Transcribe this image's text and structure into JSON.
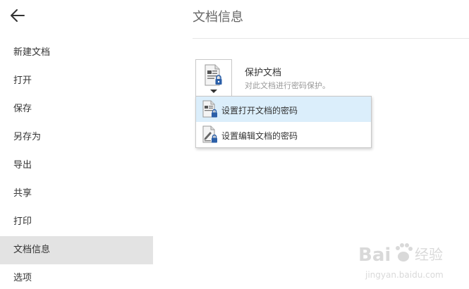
{
  "sidebar": {
    "items": [
      {
        "label": "新建文档"
      },
      {
        "label": "打开"
      },
      {
        "label": "保存"
      },
      {
        "label": "另存为"
      },
      {
        "label": "导出"
      },
      {
        "label": "共享"
      },
      {
        "label": "打印"
      },
      {
        "label": "文档信息",
        "active": true
      },
      {
        "label": "选项"
      }
    ]
  },
  "main": {
    "title": "文档信息",
    "protect": {
      "title": "保护文档",
      "description": "对此文档进行密码保护。"
    },
    "menu": {
      "items": [
        {
          "label": "设置打开文档的密码"
        },
        {
          "label": "设置编辑文档的密码"
        }
      ]
    }
  },
  "watermark": {
    "brand": "Bai",
    "brand_suffix": "经验",
    "url": "jingyan.baidu.com"
  },
  "colors": {
    "active_nav_bg": "#e3e3e3",
    "menu_hover_bg": "#dbeefb",
    "lock_blue": "#2b5fa8"
  }
}
